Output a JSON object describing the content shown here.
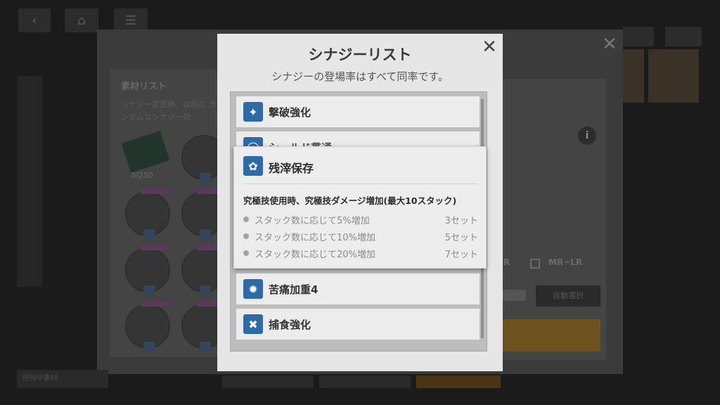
{
  "background": {
    "top_buttons": [
      "back-icon",
      "home-icon",
      "menu-icon"
    ],
    "list_title": "素材リスト",
    "list_desc": "シナジー変更時、以前の ランダムなシナジー効",
    "ticket_count": "0/250",
    "checkbox_labels": [
      "LR",
      "MR~LR"
    ],
    "auto_select_label": "自動選択",
    "bottom_left_label": "所持中素材",
    "info_icon": "i"
  },
  "dialog": {
    "title": "シナジーリスト",
    "subtitle": "シナジーの登場率はすべて同率です。",
    "close_icon": "✕",
    "synergies": [
      {
        "label": "撃破強化",
        "icon": "sword-icon"
      },
      {
        "label": "シールド貫通",
        "icon": "shield-pierce-icon"
      },
      {
        "label": "",
        "icon": ""
      },
      {
        "label": "",
        "icon": ""
      },
      {
        "label": "苦痛加重4",
        "icon": "swirl-icon"
      },
      {
        "label": "捕食強化",
        "icon": "skull-icon"
      }
    ]
  },
  "tooltip": {
    "title": "残滓保存",
    "icon": "remnant-icon",
    "description": "究極技使用時、究極技ダメージ増加(最大10スタック)",
    "effects": [
      {
        "text": "スタック数に応じて5%増加",
        "sets": "3セット"
      },
      {
        "text": "スタック数に応じて10%増加",
        "sets": "5セット"
      },
      {
        "text": "スタック数に応じて20%増加",
        "sets": "7セット"
      }
    ]
  },
  "colors": {
    "synergy_icon": "#2e6aa8",
    "overlay": "#1b1b1b"
  }
}
